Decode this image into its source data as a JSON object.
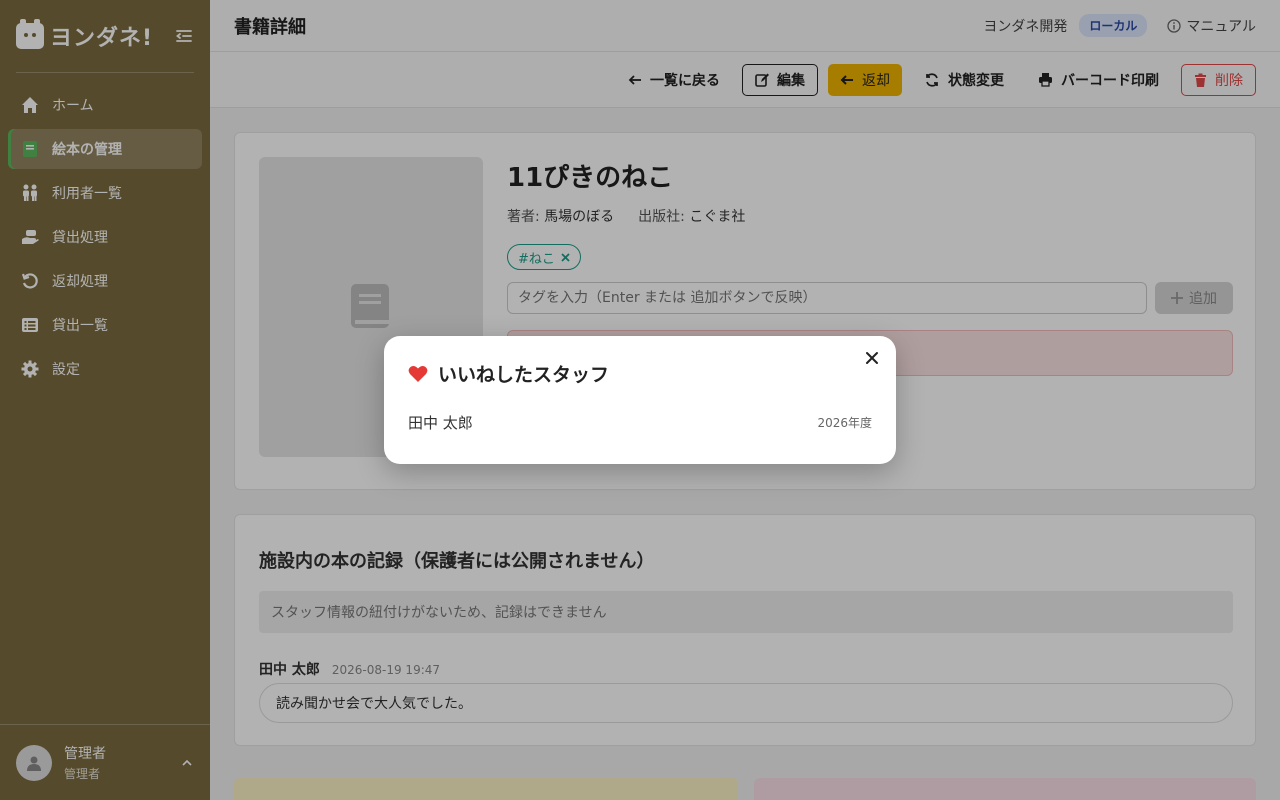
{
  "sidebar": {
    "brand": "ヨンダネ!",
    "items": [
      {
        "label": "ホーム",
        "icon": "home-icon"
      },
      {
        "label": "絵本の管理",
        "icon": "book-icon",
        "active": true
      },
      {
        "label": "利用者一覧",
        "icon": "users-icon"
      },
      {
        "label": "貸出処理",
        "icon": "hand-icon"
      },
      {
        "label": "返却処理",
        "icon": "return-icon"
      },
      {
        "label": "貸出一覧",
        "icon": "list-icon"
      },
      {
        "label": "設定",
        "icon": "gear-icon"
      }
    ],
    "user": {
      "name": "管理者",
      "role": "管理者"
    }
  },
  "header": {
    "title": "書籍詳細",
    "org": "ヨンダネ開発",
    "env": "ローカル",
    "manual": "マニュアル"
  },
  "toolbar": {
    "back": "一覧に戻る",
    "edit": "編集",
    "return": "返却",
    "status": "状態変更",
    "barcode": "バーコード印刷",
    "delete": "削除"
  },
  "book": {
    "title": "11ぴきのねこ",
    "author_label": "著者:",
    "author": "馬場のぼる",
    "publisher_label": "出版社:",
    "publisher": "こぐま社",
    "tags": [
      "#ねこ"
    ],
    "tag_placeholder": "タグを入力（Enter または 追加ボタンで反映）",
    "add_label": "追加"
  },
  "records": {
    "title": "施設内の本の記録（保護者には公開されません）",
    "alert": "スタッフ情報の紐付けがないため、記録はできません",
    "entries": [
      {
        "author": "田中 太郎",
        "timestamp": "2026-08-19 19:47",
        "text": "読み聞かせ会で大人気でした。"
      }
    ]
  },
  "modal": {
    "title": "いいねしたスタッフ",
    "staff": [
      {
        "name": "田中 太郎",
        "year": "2026年度"
      }
    ]
  },
  "colors": {
    "sidebar": "#7a6a3e",
    "accent_return": "#f0b400",
    "delete": "#e04848",
    "tag": "#1e9e8a",
    "heart": "#e53935"
  }
}
